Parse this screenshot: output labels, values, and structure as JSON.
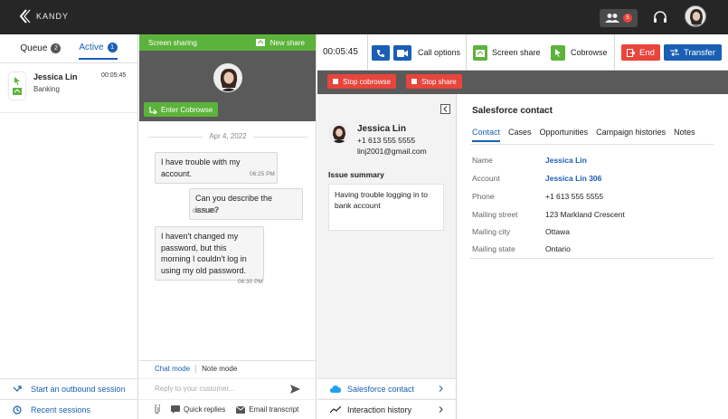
{
  "brand": {
    "name": "KANDY"
  },
  "topbar": {
    "users_count": "5"
  },
  "left": {
    "tabs": [
      {
        "label": "Queue",
        "count": "2"
      },
      {
        "label": "Active",
        "count": "1"
      }
    ],
    "conversation": {
      "name": "Jessica Lin",
      "subtitle": "Banking",
      "time": "00:05:45"
    },
    "bottom_links": [
      {
        "label": "Start an outbound session",
        "icon": "outbound-arrow-icon"
      },
      {
        "label": "Recent sessions",
        "icon": "history-clock-icon"
      }
    ]
  },
  "chat": {
    "share_header": {
      "title": "Screen sharing",
      "new_share": "New share"
    },
    "enter_cobrowse": "Enter Cobrowse",
    "date": "Apr 4, 2022",
    "messages": [
      {
        "side": "customer",
        "text": "I have trouble with my account.",
        "time": "06:25 PM"
      },
      {
        "side": "agent",
        "text": "Can you describe the issue?",
        "time": "06:26 PM"
      },
      {
        "side": "customer",
        "text": "I haven't changed my password, but this morning I couldn't log in using my old password.",
        "time": "06:30 PM"
      }
    ],
    "modes": {
      "chat": "Chat mode",
      "note": "Note mode"
    },
    "reply_placeholder": "Reply to your customer...",
    "tools": {
      "quick_replies": "Quick replies",
      "email_transcript": "Email transcript"
    }
  },
  "call": {
    "timer": "00:05:45",
    "call_options": "Call options",
    "screen_share": "Screen share",
    "cobrowse": "Cobrowse",
    "end": "End",
    "transfer": "Transfer",
    "stop_cobrowse": "Stop cobrowse",
    "stop_share": "Stop share"
  },
  "contact": {
    "name": "Jessica Lin",
    "phone": "+1 613 555 5555",
    "email": "linj2001@gmail.com",
    "issue_label": "Issue summary",
    "issue_text": "Having trouble logging in to bank account",
    "accordion": [
      {
        "label": "Salesforce contact",
        "icon": "salesforce-cloud-icon"
      },
      {
        "label": "Interaction history",
        "icon": "trend-line-icon"
      }
    ]
  },
  "salesforce": {
    "title": "Salesforce contact",
    "tabs": [
      "Contact",
      "Cases",
      "Opportunities",
      "Campaign histories",
      "Notes"
    ],
    "fields": [
      {
        "key": "Name",
        "value": "Jessica Lin",
        "link": true
      },
      {
        "key": "Account",
        "value": "Jessica Lin 306",
        "link": true
      },
      {
        "key": "Phone",
        "value": "+1 613 555 5555",
        "link": false
      },
      {
        "key": "Mailing street",
        "value": "123 Markland Crescent",
        "link": false
      },
      {
        "key": "Mailing city",
        "value": "Ottawa",
        "link": false
      },
      {
        "key": "Mailing state",
        "value": "Ontario",
        "link": false
      }
    ]
  },
  "colors": {
    "accent": "#1a5fb4",
    "green": "#5cb33b",
    "danger": "#e8453c",
    "topbar": "#262626"
  }
}
